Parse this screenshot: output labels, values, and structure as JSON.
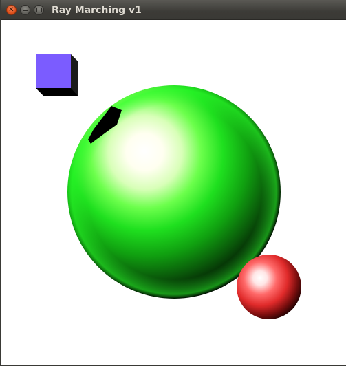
{
  "window": {
    "title": "Ray Marching v1"
  },
  "scene": {
    "background_color": "#ffffff",
    "objects": [
      {
        "name": "cube",
        "color": "#7b5cff",
        "shadow_color": "#000000"
      },
      {
        "name": "large-sphere",
        "color": "#1fe01f",
        "highlight_color": "#fffff0"
      },
      {
        "name": "small-sphere",
        "color": "#f03030",
        "highlight_color": "#ffffff"
      }
    ]
  },
  "icons": {
    "close": "close-icon",
    "minimize": "minimize-icon",
    "maximize": "maximize-icon"
  }
}
